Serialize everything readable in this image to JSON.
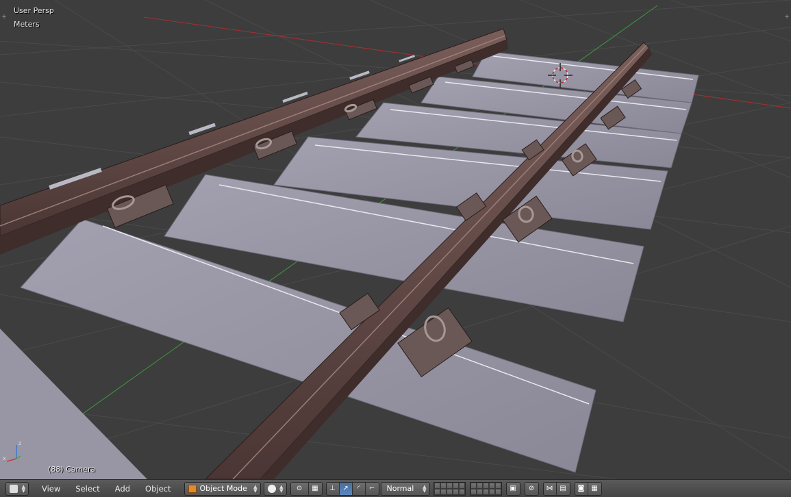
{
  "viewport": {
    "view_name": "User Persp",
    "units": "Meters",
    "object_info": "(88) Camera",
    "corner_left": "+",
    "corner_right": "+",
    "axis_x": "x",
    "axis_z": "z"
  },
  "header": {
    "editor_icon": "3d-view-icon",
    "menus": {
      "view": "View",
      "select": "Select",
      "add": "Add",
      "object": "Object"
    },
    "mode": "Object Mode",
    "pivot_orientation": "Normal"
  },
  "colors": {
    "viewport_bg": "#3d3d3d",
    "rail": "#5e4644",
    "sleeper": "#9593a2",
    "x_axis": "#a63030",
    "y_axis": "#3f9a3f",
    "header": "#4e4e4e",
    "active_button": "#5680c2"
  }
}
